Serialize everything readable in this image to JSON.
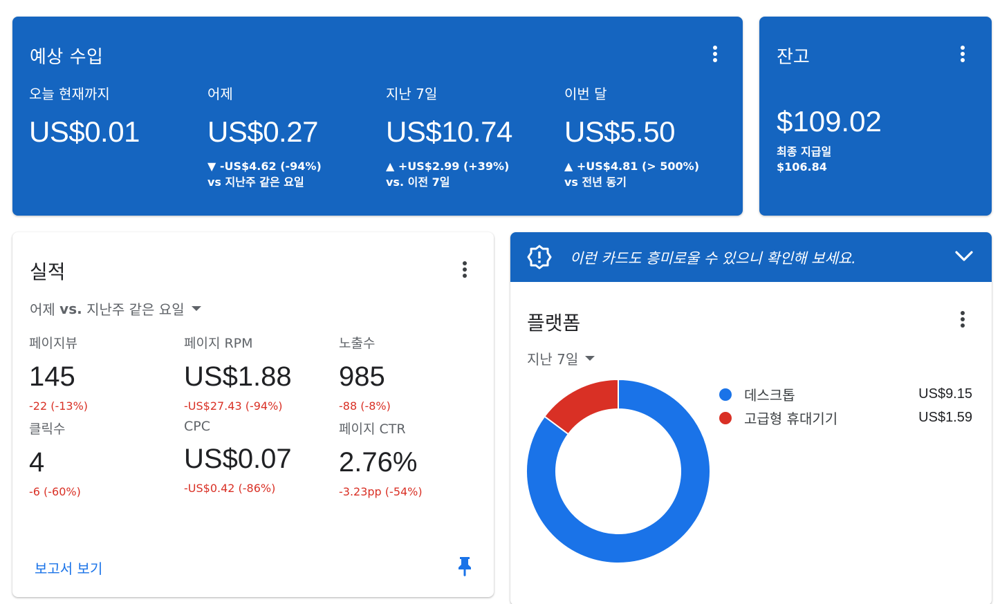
{
  "earnings": {
    "title": "예상 수입",
    "metrics": [
      {
        "label": "오늘 현재까지",
        "value": "US$0.01",
        "delta": "",
        "compare": ""
      },
      {
        "label": "어제",
        "value": "US$0.27",
        "delta": "▼ -US$4.62 (-94%)",
        "compare": "vs 지난주 같은 요일"
      },
      {
        "label": "지난 7일",
        "value": "US$10.74",
        "delta": "▲ +US$2.99 (+39%)",
        "compare": "vs. 이전 7일"
      },
      {
        "label": "이번 달",
        "value": "US$5.50",
        "delta": "▲ +US$4.81 (> 500%)",
        "compare": "vs 전년 동기"
      }
    ]
  },
  "balance": {
    "title": "잔고",
    "amount": "$109.02",
    "last_payment_label": "최종 지급일",
    "last_payment_value": "$106.84"
  },
  "performance": {
    "title": "실적",
    "range_prefix": "어제 ",
    "range_vs": "vs.",
    "range_suffix": " 지난주 같은 요일",
    "metrics": [
      {
        "label": "페이지뷰",
        "value": "145",
        "change": "-22 (-13%)"
      },
      {
        "label": "페이지 RPM",
        "value": "US$1.88",
        "change": "-US$27.43 (-94%)"
      },
      {
        "label": "노출수",
        "value": "985",
        "change": "-88 (-8%)"
      },
      {
        "label": "클릭수",
        "value": "4",
        "change": "-6 (-60%)"
      },
      {
        "label": "CPC",
        "value": "US$0.07",
        "change": "-US$0.42 (-86%)"
      },
      {
        "label": "페이지 CTR",
        "value": "2.76%",
        "change": "-3.23pp (-54%)"
      }
    ],
    "report_link": "보고서 보기"
  },
  "suggestion": {
    "banner_text": "이런 카드도 흥미로울 수 있으니 확인해 보세요."
  },
  "platform": {
    "title": "플랫폼",
    "range": "지난 7일",
    "colors": {
      "desktop": "#1a73e8",
      "tablet": "#d93025"
    }
  },
  "chart_data": {
    "type": "pie",
    "donut": true,
    "categories": [
      "데스크톱",
      "고급형 휴대기기"
    ],
    "values": [
      9.15,
      1.59
    ],
    "value_labels": [
      "US$9.15",
      "US$1.59"
    ],
    "colors": [
      "#1a73e8",
      "#d93025"
    ],
    "legend": "right"
  }
}
